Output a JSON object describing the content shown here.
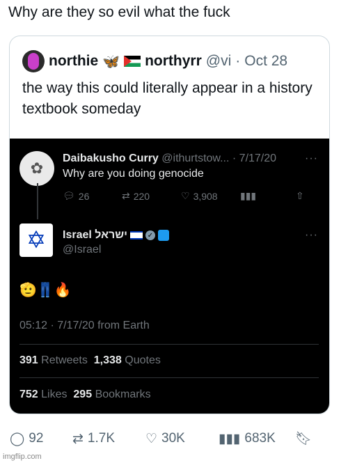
{
  "caption": "Why are they so evil what the fuck",
  "quoted": {
    "name": "northie",
    "butterfly": "🦋",
    "handle_name": "northyrr",
    "handle": "@vi",
    "dot": "·",
    "date": "Oct 28",
    "text": "the way this could literally appear in a history textbook someday"
  },
  "screenshot": {
    "tweet1": {
      "name": "Daibakusho Curry",
      "handle": "@ithurtstow...",
      "date": "· 7/17/20",
      "text": "Why are you doing genocide",
      "replies": "26",
      "retweets": "220",
      "likes": "3,908"
    },
    "tweet2": {
      "name": "Israel ישראל",
      "handle": "@Israel",
      "emojis": "🫡👖🔥",
      "meta": "05:12 · 7/17/20 from Earth",
      "retweets_num": "391",
      "retweets_label": "Retweets",
      "quotes_num": "1,338",
      "quotes_label": "Quotes",
      "likes_num": "752",
      "likes_label": "Likes",
      "bookmarks_num": "295",
      "bookmarks_label": "Bookmarks"
    }
  },
  "actions": {
    "replies": "92",
    "retweets": "1.7K",
    "likes": "30K",
    "views": "683K"
  },
  "watermark": "imgflip.com"
}
